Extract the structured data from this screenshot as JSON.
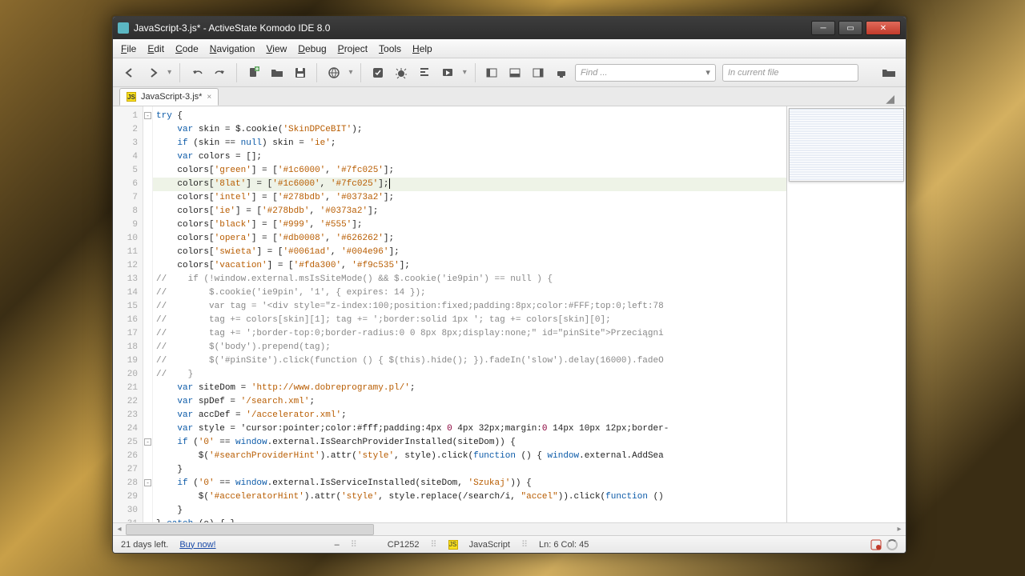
{
  "window": {
    "title": "JavaScript-3.js* - ActiveState Komodo IDE 8.0"
  },
  "menu": [
    "File",
    "Edit",
    "Code",
    "Navigation",
    "View",
    "Debug",
    "Project",
    "Tools",
    "Help"
  ],
  "find": {
    "placeholder": "Find ...",
    "scope": "In current file"
  },
  "tab": {
    "label": "JavaScript-3.js*"
  },
  "status": {
    "trial": "21 days left.",
    "buy": "Buy now!",
    "dash": "–",
    "encoding": "CP1252",
    "lang": "JavaScript",
    "pos": "Ln: 6 Col: 45"
  },
  "highlight_line": 6,
  "cursor": {
    "line": 6,
    "col": 45
  },
  "fold_markers": [
    1,
    25,
    28
  ],
  "code_lines": [
    "try {",
    "    var skin = $.cookie('SkinDPCeBIT');",
    "    if (skin == null) skin = 'ie';",
    "    var colors = [];",
    "    colors['green'] = ['#1c6000', '#7fc025'];",
    "    colors['8lat'] = ['#1c6000', '#7fc025'];",
    "    colors['intel'] = ['#278bdb', '#0373a2'];",
    "    colors['ie'] = ['#278bdb', '#0373a2'];",
    "    colors['black'] = ['#999', '#555'];",
    "    colors['opera'] = ['#db0008', '#626262'];",
    "    colors['swieta'] = ['#0061ad', '#004e96'];",
    "    colors['vacation'] = ['#fda300', '#f9c535'];",
    "//    if (!window.external.msIsSiteMode() && $.cookie('ie9pin') == null ) {",
    "//        $.cookie('ie9pin', '1', { expires: 14 });",
    "//        var tag = '<div style=\"z-index:100;position:fixed;padding:8px;color:#FFF;top:0;left:78",
    "//        tag += colors[skin][1]; tag += ';border:solid 1px '; tag += colors[skin][0];",
    "//        tag += ';border-top:0;border-radius:0 0 8px 8px;display:none;\" id=\"pinSite\">Przeciągni",
    "//        $('body').prepend(tag);",
    "//        $('#pinSite').click(function () { $(this).hide(); }).fadeIn('slow').delay(16000).fadeO",
    "//    }",
    "    var siteDom = 'http://www.dobreprogramy.pl/';",
    "    var spDef = '/search.xml';",
    "    var accDef = '/accelerator.xml';",
    "    var style = 'cursor:pointer;color:#fff;padding:4px 0 4px 32px;margin:0 14px 10px 12px;border-",
    "    if ('0' == window.external.IsSearchProviderInstalled(siteDom)) {",
    "        $('#searchProviderHint').attr('style', style).click(function () { window.external.AddSea",
    "    }",
    "    if ('0' == window.external.IsServiceInstalled(siteDom, 'Szukaj')) {",
    "        $('#acceleratorHint').attr('style', style.replace(/search/i, \"accel\")).click(function ()",
    "    }",
    "} catch (e) { }"
  ]
}
